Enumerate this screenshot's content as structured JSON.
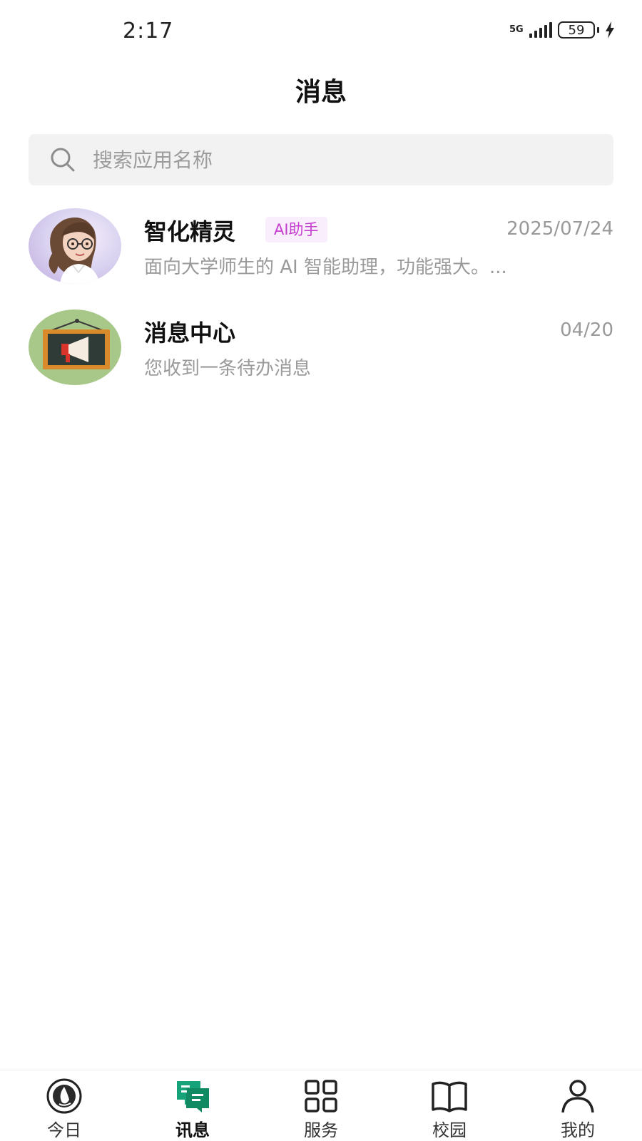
{
  "status_bar": {
    "time": "2:17",
    "network": "5G",
    "battery": "59"
  },
  "header": {
    "title": "消息"
  },
  "search": {
    "placeholder": "搜索应用名称"
  },
  "messages": [
    {
      "name": "智化精灵",
      "badge": "AI助手",
      "time": "2025/07/24",
      "preview": "面向大学师生的 AI 智能助理，功能强大。..."
    },
    {
      "name": "消息中心",
      "time": "04/20",
      "preview": "您收到一条待办消息"
    }
  ],
  "bottom_nav": {
    "items": [
      {
        "label": "今日",
        "icon": "school-logo-icon"
      },
      {
        "label": "讯息",
        "icon": "chat-icon",
        "active": true
      },
      {
        "label": "服务",
        "icon": "grid-icon"
      },
      {
        "label": "校园",
        "icon": "book-icon"
      },
      {
        "label": "我的",
        "icon": "user-icon"
      }
    ]
  },
  "colors": {
    "accent": "#16a37a",
    "badge_bg": "#f8eefc",
    "badge_text": "#c43dcf",
    "search_bg": "#f2f2f2"
  }
}
